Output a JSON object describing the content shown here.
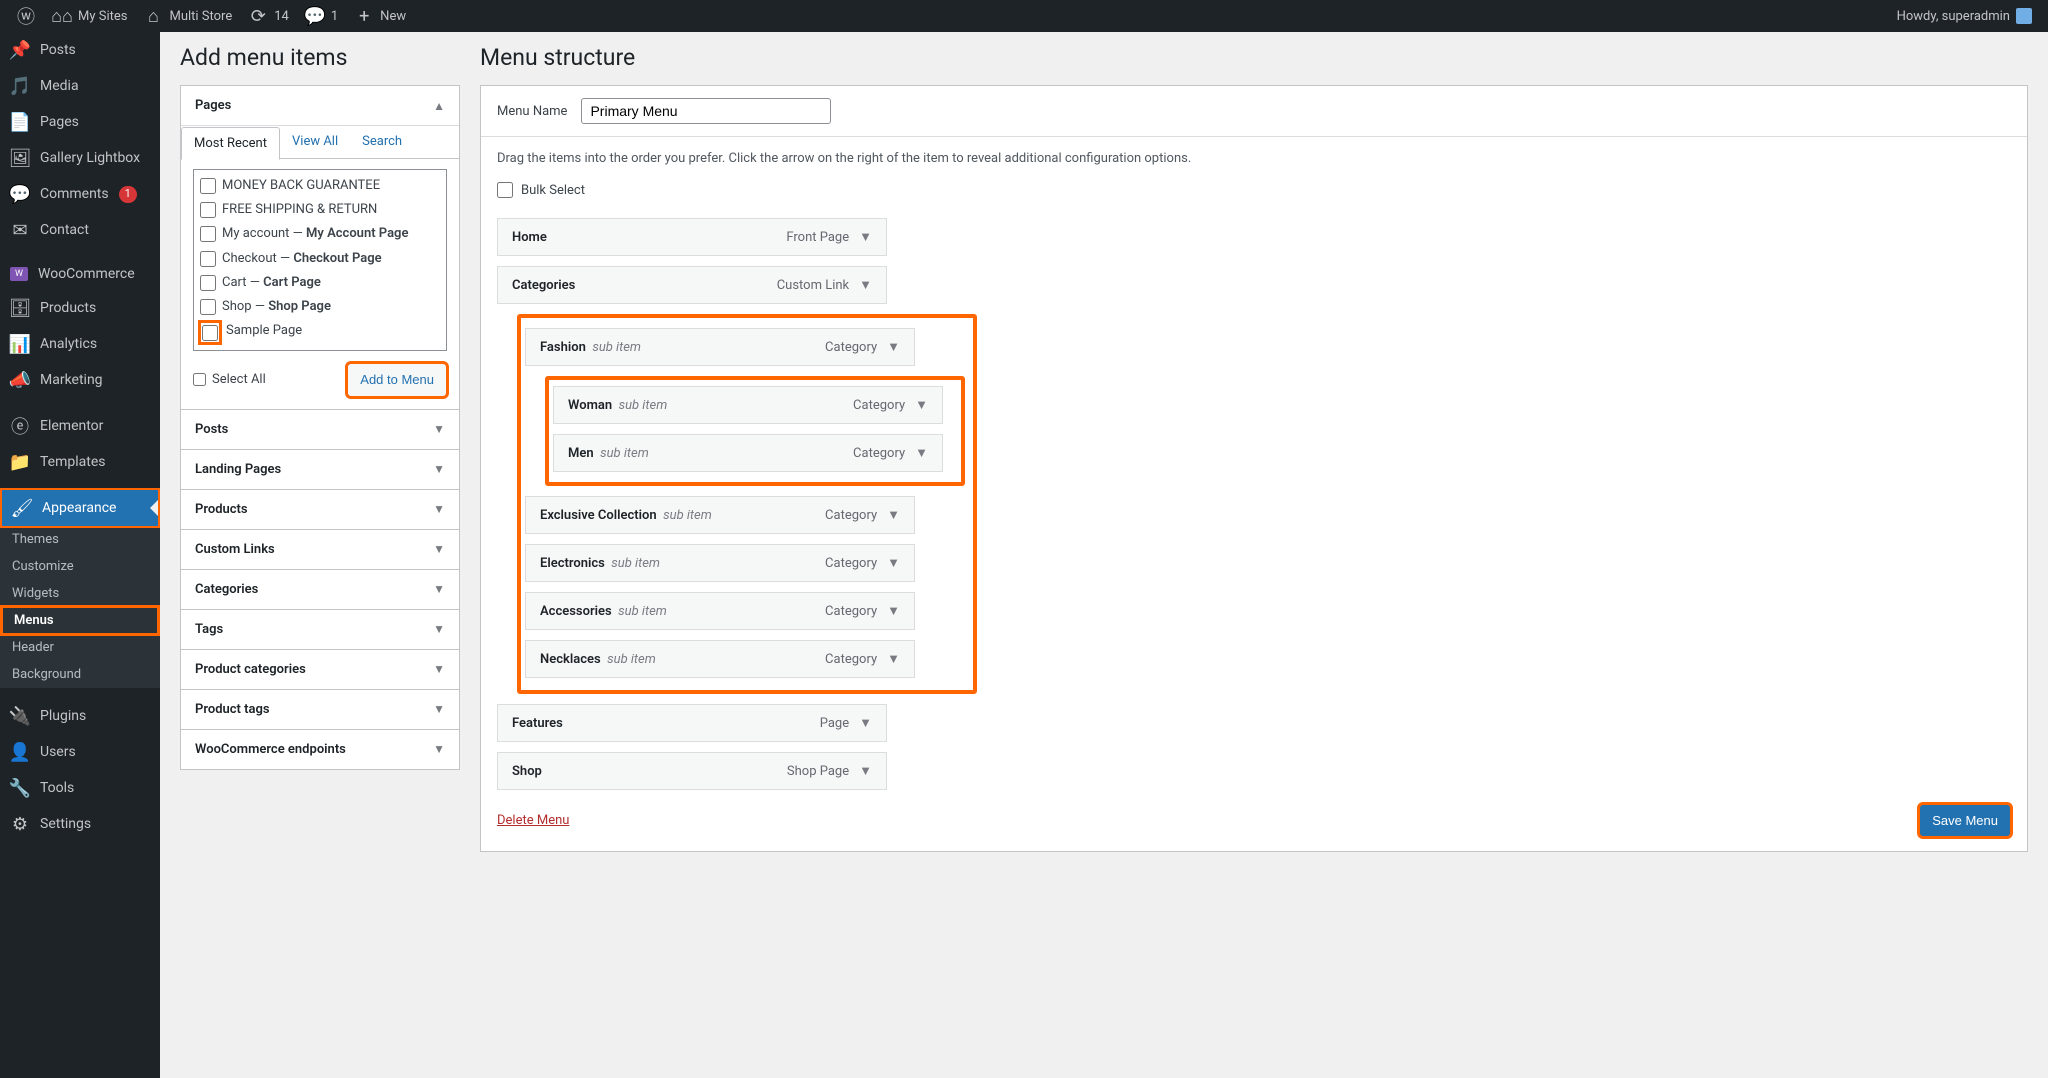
{
  "adminbar": {
    "my_sites": "My Sites",
    "site_name": "Multi Store",
    "updates_count": "14",
    "comments_count": "1",
    "new_label": "New",
    "howdy": "Howdy, superadmin"
  },
  "sidemenu": {
    "posts": "Posts",
    "media": "Media",
    "pages": "Pages",
    "gallery": "Gallery Lightbox",
    "comments": "Comments",
    "comments_badge": "1",
    "contact": "Contact",
    "woocommerce": "WooCommerce",
    "products": "Products",
    "analytics": "Analytics",
    "marketing": "Marketing",
    "elementor": "Elementor",
    "templates": "Templates",
    "appearance": "Appearance",
    "plugins": "Plugins",
    "users": "Users",
    "tools": "Tools",
    "settings": "Settings",
    "sub_themes": "Themes",
    "sub_customize": "Customize",
    "sub_widgets": "Widgets",
    "sub_menus": "Menus",
    "sub_header": "Header",
    "sub_background": "Background"
  },
  "left": {
    "heading": "Add menu items",
    "pages_box": "Pages",
    "tabs": {
      "most_recent": "Most Recent",
      "view_all": "View All",
      "search": "Search"
    },
    "pages": [
      {
        "label": "MONEY BACK GUARANTEE",
        "suffix": ""
      },
      {
        "label": "FREE SHIPPING & RETURN",
        "suffix": ""
      },
      {
        "label": "My account",
        "suffix": "My Account Page"
      },
      {
        "label": "Checkout",
        "suffix": "Checkout Page"
      },
      {
        "label": "Cart",
        "suffix": "Cart Page"
      },
      {
        "label": "Shop",
        "suffix": "Shop Page"
      },
      {
        "label": "Sample Page",
        "suffix": ""
      }
    ],
    "select_all": "Select All",
    "add_to_menu": "Add to Menu",
    "boxes": {
      "posts": "Posts",
      "landing": "Landing Pages",
      "products": "Products",
      "custom_links": "Custom Links",
      "categories": "Categories",
      "tags": "Tags",
      "product_cats": "Product categories",
      "product_tags": "Product tags",
      "woo_endpoints": "WooCommerce endpoints"
    }
  },
  "right": {
    "heading": "Menu structure",
    "menu_name_label": "Menu Name",
    "menu_name_value": "Primary Menu",
    "instructions": "Drag the items into the order you prefer. Click the arrow on the right of the item to reveal additional configuration options.",
    "bulk_select": "Bulk Select",
    "items": {
      "home": {
        "title": "Home",
        "type": "Front Page"
      },
      "categories": {
        "title": "Categories",
        "type": "Custom Link"
      },
      "fashion": {
        "title": "Fashion",
        "sub": "sub item",
        "type": "Category"
      },
      "woman": {
        "title": "Woman",
        "sub": "sub item",
        "type": "Category"
      },
      "men": {
        "title": "Men",
        "sub": "sub item",
        "type": "Category"
      },
      "exclusive": {
        "title": "Exclusive Collection",
        "sub": "sub item",
        "type": "Category"
      },
      "electronics": {
        "title": "Electronics",
        "sub": "sub item",
        "type": "Category"
      },
      "accessories": {
        "title": "Accessories",
        "sub": "sub item",
        "type": "Category"
      },
      "necklaces": {
        "title": "Necklaces",
        "sub": "sub item",
        "type": "Category"
      },
      "features": {
        "title": "Features",
        "type": "Page"
      },
      "shop": {
        "title": "Shop",
        "type": "Shop Page"
      }
    },
    "delete_menu": "Delete Menu",
    "save_menu": "Save Menu"
  }
}
